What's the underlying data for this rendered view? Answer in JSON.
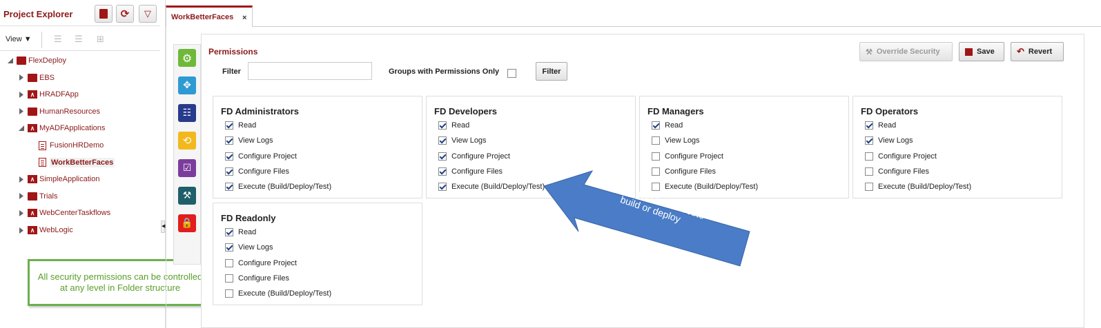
{
  "explorer": {
    "title": "Project Explorer",
    "view_label": "View",
    "tree": [
      {
        "label": "FlexDeploy",
        "type": "folder",
        "level": 0,
        "expanded": true
      },
      {
        "label": "EBS",
        "type": "folder",
        "level": 1,
        "expanded": false
      },
      {
        "label": "HRADFApp",
        "type": "adf",
        "level": 1,
        "expanded": false
      },
      {
        "label": "HumanResources",
        "type": "folder",
        "level": 1,
        "expanded": false
      },
      {
        "label": "MyADFApplications",
        "type": "adf",
        "level": 1,
        "expanded": true
      },
      {
        "label": "FusionHRDemo",
        "type": "project",
        "level": 2
      },
      {
        "label": "WorkBetterFaces",
        "type": "project",
        "level": 2,
        "selected": true
      },
      {
        "label": "SimpleApplication",
        "type": "adf",
        "level": 1,
        "expanded": false
      },
      {
        "label": "Trials",
        "type": "folder",
        "level": 1,
        "expanded": false
      },
      {
        "label": "WebCenterTaskflows",
        "type": "adf",
        "level": 1,
        "expanded": false
      },
      {
        "label": "WebLogic",
        "type": "adf",
        "level": 1,
        "expanded": false
      }
    ]
  },
  "note": "All security permissions can be controlled at any level in Folder structure",
  "tab": {
    "label": "WorkBetterFaces",
    "close": "×"
  },
  "permissions": {
    "title": "Permissions",
    "filter_label": "Filter",
    "filter_value": "",
    "groups_only_label": "Groups with Permissions Only",
    "filter_button": "Filter",
    "override_button": "Override Security",
    "save_button": "Save",
    "revert_button": "Revert"
  },
  "groups": [
    {
      "name": "FD Administrators",
      "perms": [
        {
          "label": "Read",
          "checked": true
        },
        {
          "label": "View Logs",
          "checked": true
        },
        {
          "label": "Configure Project",
          "checked": true
        },
        {
          "label": "Configure Files",
          "checked": true
        },
        {
          "label": "Execute (Build/Deploy/Test)",
          "checked": true
        }
      ]
    },
    {
      "name": "FD Developers",
      "perms": [
        {
          "label": "Read",
          "checked": true
        },
        {
          "label": "View Logs",
          "checked": true
        },
        {
          "label": "Configure Project",
          "checked": true
        },
        {
          "label": "Configure Files",
          "checked": true
        },
        {
          "label": "Execute (Build/Deploy/Test)",
          "checked": true
        }
      ]
    },
    {
      "name": "FD Managers",
      "perms": [
        {
          "label": "Read",
          "checked": true
        },
        {
          "label": "View Logs",
          "checked": false
        },
        {
          "label": "Configure Project",
          "checked": false
        },
        {
          "label": "Configure Files",
          "checked": false
        },
        {
          "label": "Execute (Build/Deploy/Test)",
          "checked": false
        }
      ]
    },
    {
      "name": "FD Operators",
      "perms": [
        {
          "label": "Read",
          "checked": true
        },
        {
          "label": "View Logs",
          "checked": true
        },
        {
          "label": "Configure Project",
          "checked": false
        },
        {
          "label": "Configure Files",
          "checked": false
        },
        {
          "label": "Execute (Build/Deploy/Test)",
          "checked": false
        }
      ]
    },
    {
      "name": "FD Readonly",
      "perms": [
        {
          "label": "Read",
          "checked": true
        },
        {
          "label": "View Logs",
          "checked": true
        },
        {
          "label": "Configure Project",
          "checked": false
        },
        {
          "label": "Configure Files",
          "checked": false
        },
        {
          "label": "Execute (Build/Deploy/Test)",
          "checked": false
        }
      ]
    }
  ],
  "callout": "Control who can execute build or deploy",
  "colors": {
    "brand": "#a01616",
    "callout": "#4a7cc7",
    "note": "#6ab04c"
  }
}
